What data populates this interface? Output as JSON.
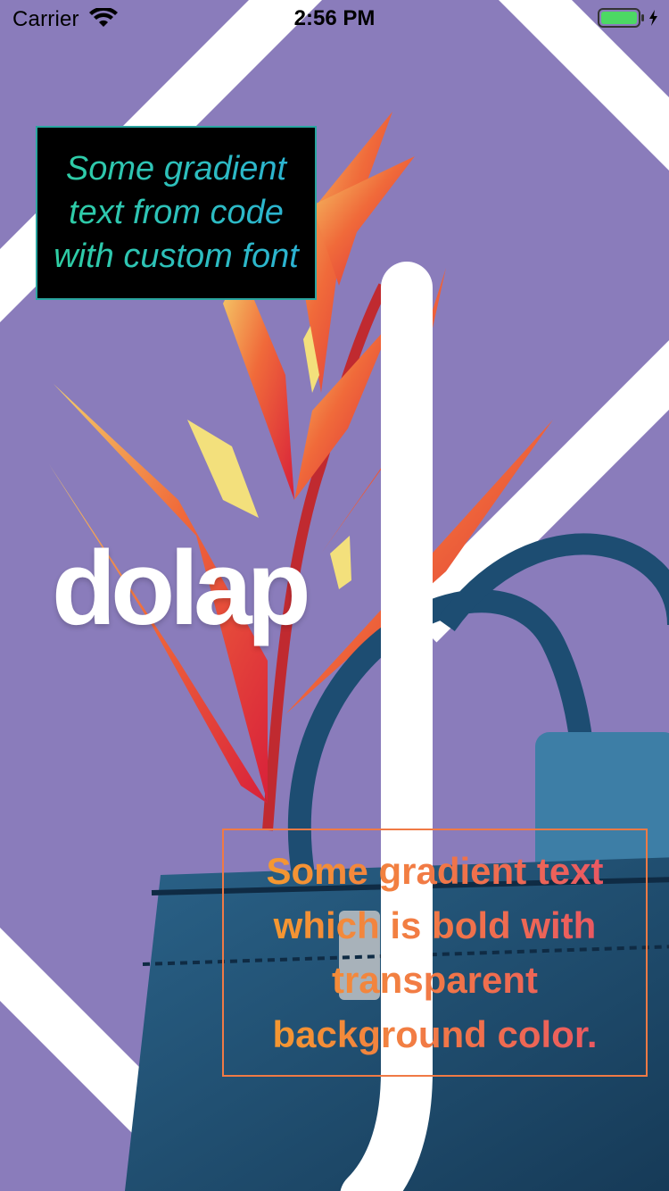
{
  "status_bar": {
    "carrier": "Carrier",
    "time": "2:56 PM",
    "wifi_icon": "wifi-icon",
    "battery_icon": "battery-charging-icon",
    "battery_color": "#4cd964"
  },
  "background": {
    "color": "#8a7cbb",
    "stripe_color": "#ffffff",
    "flower_color": "#e8423a",
    "bag_color": "#1f4e72"
  },
  "logo": {
    "text": "dolap"
  },
  "gradient_label_1": {
    "text": "Some gradient text from code with custom font",
    "border_color": "#2aa5a0",
    "gradient_start": "#2fd0a0",
    "gradient_end": "#2bb0d6",
    "background_color": "#000000"
  },
  "gradient_label_2": {
    "text": "Some gradient text which is bold with transparent background color.",
    "border_color": "#f07a45",
    "gradient_start": "#f6a12a",
    "gradient_end": "#e8506a"
  }
}
